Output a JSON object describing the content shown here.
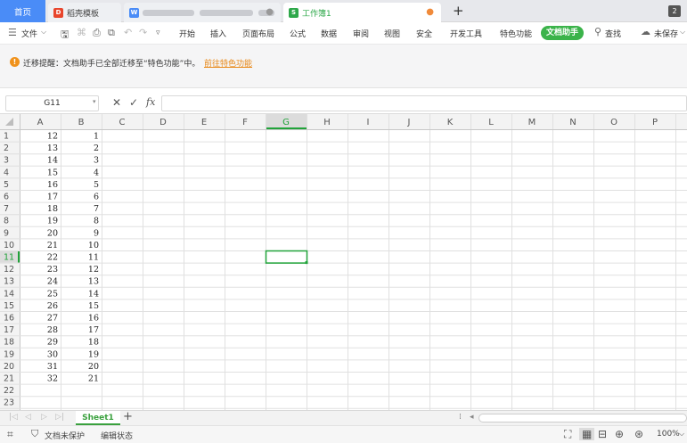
{
  "tabs": {
    "home": "首页",
    "docer": "稻壳模板",
    "docer_icon_letter": "D",
    "word_icon_letter": "W",
    "workbook": "工作簿1",
    "workbook_icon_letter": "S",
    "window_count": "2"
  },
  "menu": {
    "file": "文件",
    "items": [
      "开始",
      "插入",
      "页面布局",
      "公式",
      "数据",
      "审阅",
      "视图",
      "安全",
      "开发工具",
      "特色功能"
    ],
    "helper": "文档助手",
    "search": "查找",
    "save_status": "未保存"
  },
  "notice": {
    "text": "迁移提醒：文档助手已全部迁移至“特色功能”中。",
    "link": "前往特色功能"
  },
  "formula": {
    "cell_ref": "G11",
    "cancel_symbol": "✕",
    "confirm_symbol": "✓",
    "fx": "fx",
    "value": ""
  },
  "grid": {
    "columns": [
      "A",
      "B",
      "C",
      "D",
      "E",
      "F",
      "G",
      "H",
      "I",
      "J",
      "K",
      "L",
      "M",
      "N",
      "O",
      "P"
    ],
    "rows": [
      "1",
      "2",
      "3",
      "4",
      "5",
      "6",
      "7",
      "8",
      "9",
      "10",
      "11",
      "12",
      "13",
      "14",
      "15",
      "16",
      "17",
      "18",
      "19",
      "20",
      "21",
      "22",
      "23"
    ],
    "col_a": [
      "12",
      "13",
      "14",
      "15",
      "16",
      "17",
      "18",
      "19",
      "20",
      "21",
      "22",
      "23",
      "24",
      "25",
      "26",
      "27",
      "28",
      "29",
      "30",
      "31",
      "32"
    ],
    "col_b": [
      "1",
      "2",
      "3",
      "4",
      "5",
      "6",
      "7",
      "8",
      "9",
      "10",
      "11",
      "12",
      "13",
      "14",
      "15",
      "16",
      "17",
      "18",
      "19",
      "20",
      "21"
    ],
    "selected_column": "G",
    "selected_row": "11",
    "selection_color": "#21a33a"
  },
  "sheet_tabs": {
    "active": "Sheet1",
    "add_symbol": "+"
  },
  "status": {
    "protection": "文档未保护",
    "edit_state": "编辑状态",
    "zoom": "100%"
  }
}
